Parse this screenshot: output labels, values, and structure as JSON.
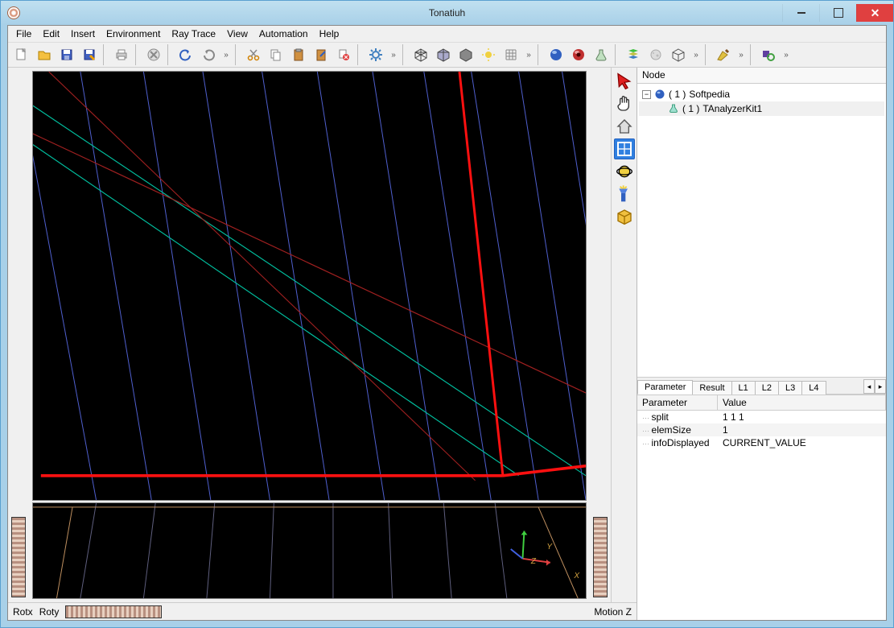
{
  "window": {
    "title": "Tonatiuh"
  },
  "menu": {
    "items": [
      "File",
      "Edit",
      "Insert",
      "Environment",
      "Ray Trace",
      "View",
      "Automation",
      "Help"
    ]
  },
  "statusbar": {
    "rotx": "Rotx",
    "roty": "Roty",
    "motionz": "Motion Z"
  },
  "tree": {
    "header": "Node",
    "root_num": "( 1 )",
    "root_name": "Softpedia",
    "child_num": "( 1 )",
    "child_name": "TAnalyzerKit1"
  },
  "tabs": {
    "names": [
      "Parameter",
      "Result",
      "L1",
      "L2",
      "L3",
      "L4"
    ]
  },
  "params": {
    "head_param": "Parameter",
    "head_value": "Value",
    "rows": [
      {
        "name": "split",
        "value": "1 1 1"
      },
      {
        "name": "elemSize",
        "value": "1"
      },
      {
        "name": "infoDisplayed",
        "value": "CURRENT_VALUE"
      }
    ]
  },
  "axis": {
    "x": "X",
    "y": "Y",
    "z": "Z"
  }
}
